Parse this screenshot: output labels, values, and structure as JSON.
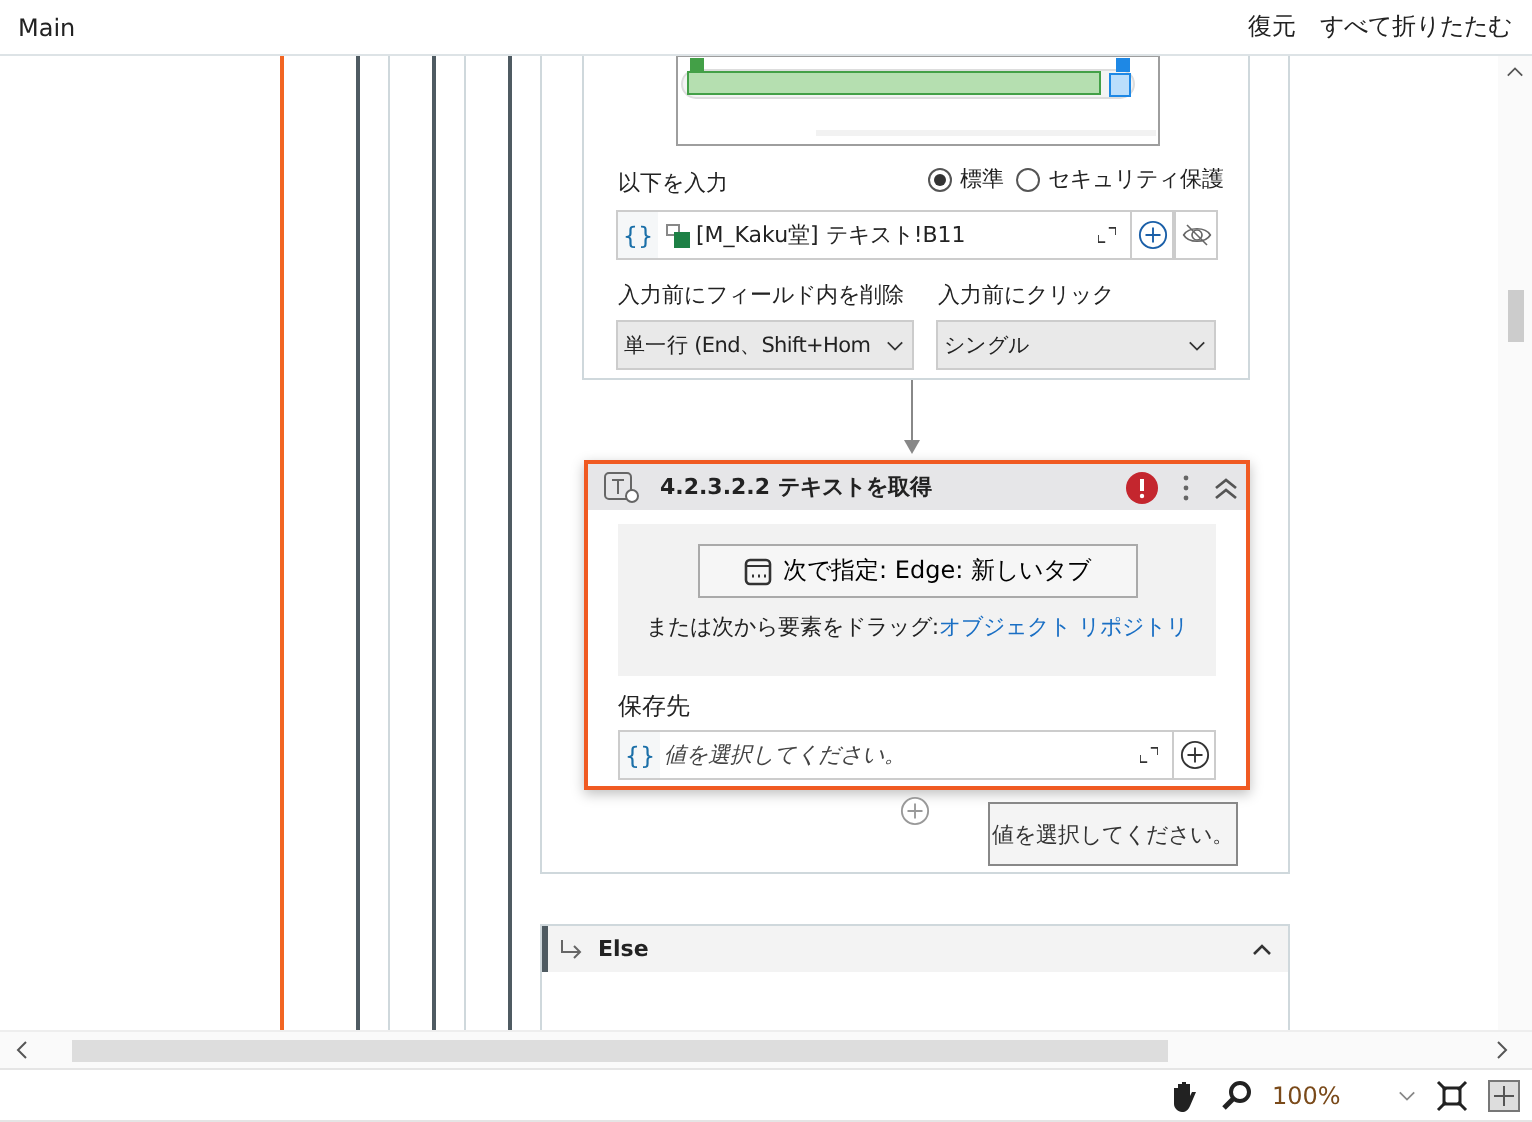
{
  "header": {
    "title": "Main",
    "actions": [
      "復元",
      "すべて折りたたむ"
    ]
  },
  "type_into": {
    "input_label": "以下を入力",
    "input_modes": [
      {
        "label": "標準",
        "selected": true
      },
      {
        "label": "セキュリティ保護",
        "selected": false
      }
    ],
    "variable_mark": "{}",
    "input_value": "[M_Kaku堂] テキスト!B11",
    "clear_label": "入力前にフィールド内を削除",
    "clear_value": "単一行 (End、Shift+Hom",
    "click_label": "入力前にクリック",
    "click_value": "シングル"
  },
  "get_text": {
    "title": "4.2.3.2.2 テキストを取得",
    "error": true,
    "indicate_button": "次で指定:  Edge: 新しいタブ",
    "drag_text": "または次から要素をドラッグ:",
    "repo_link": "オブジェクト リポジトリ",
    "save_label": "保存先",
    "variable_mark": "{}",
    "save_placeholder": "値を選択してください。"
  },
  "tooltip": "値を選択してください。",
  "else_branch": {
    "title": "Else",
    "expanded": true
  },
  "status_bar": {
    "zoom": "100%"
  }
}
